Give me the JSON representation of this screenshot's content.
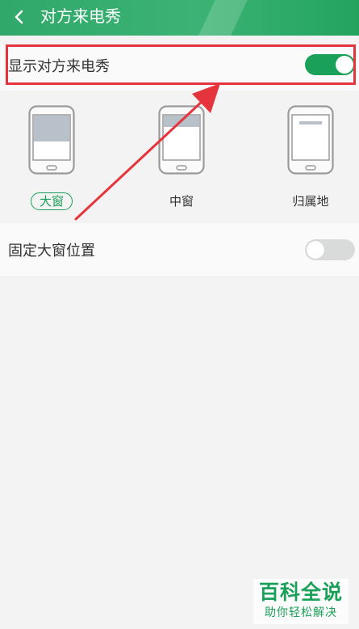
{
  "header": {
    "title": "对方来电秀"
  },
  "settings": {
    "show_caller_show": {
      "label": "显示对方来电秀",
      "enabled": true
    },
    "fixed_large_window": {
      "label": "固定大窗位置",
      "enabled": false
    }
  },
  "display_options": [
    {
      "label": "大窗",
      "selected": true
    },
    {
      "label": "中窗",
      "selected": false
    },
    {
      "label": "归属地",
      "selected": false
    }
  ],
  "watermark": {
    "title": "百科全说",
    "subtitle": "助你轻松解决"
  },
  "colors": {
    "accent": "#1aa058",
    "header": "#3cb374",
    "highlight": "#e5343b",
    "toggle_off": "#d9dbda"
  }
}
